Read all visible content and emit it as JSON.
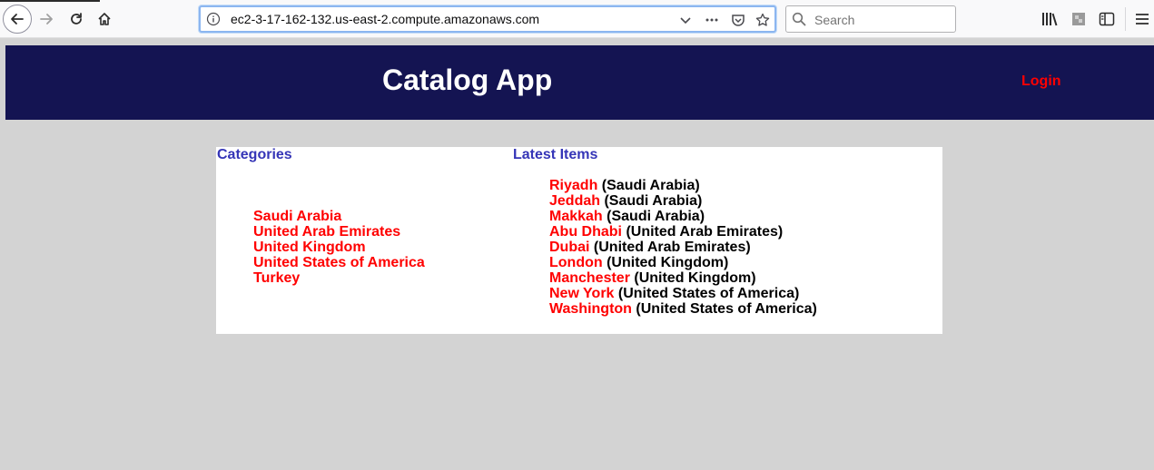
{
  "browser": {
    "url": "ec2-3-17-162-132.us-east-2.compute.amazonaws.com",
    "search_placeholder": "Search"
  },
  "header": {
    "title": "Catalog App",
    "login_label": "Login"
  },
  "categories": {
    "heading": "Categories",
    "items": [
      "Saudi Arabia",
      "United Arab Emirates",
      "United Kingdom",
      "United States of America",
      "Turkey"
    ]
  },
  "latest": {
    "heading": "Latest Items",
    "items": [
      {
        "name": "Riyadh",
        "category": "(Saudi Arabia)"
      },
      {
        "name": "Jeddah",
        "category": "(Saudi Arabia)"
      },
      {
        "name": "Makkah",
        "category": "(Saudi Arabia)"
      },
      {
        "name": "Abu Dhabi",
        "category": "(United Arab Emirates)"
      },
      {
        "name": "Dubai",
        "category": "(United Arab Emirates)"
      },
      {
        "name": "London",
        "category": "(United Kingdom)"
      },
      {
        "name": "Manchester",
        "category": "(United Kingdom)"
      },
      {
        "name": "New York",
        "category": "(United States of America)"
      },
      {
        "name": "Washington",
        "category": "(United States of America)"
      }
    ]
  },
  "colors": {
    "header_bg": "#141452",
    "link": "#ff0000",
    "heading": "#3535b7",
    "page_bg": "#d3d3d3"
  }
}
